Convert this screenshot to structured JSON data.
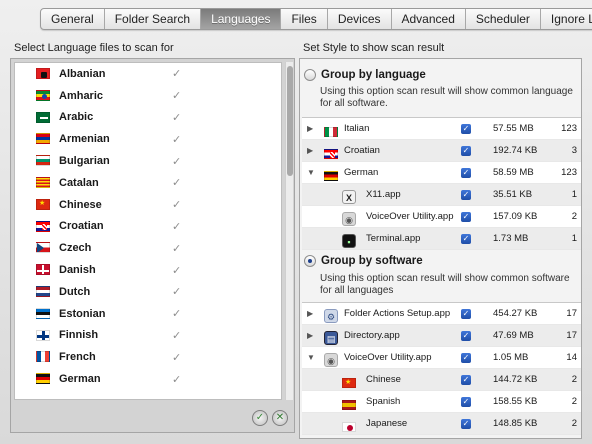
{
  "tabs": [
    {
      "label": "General",
      "active": false
    },
    {
      "label": "Folder Search",
      "active": false
    },
    {
      "label": "Languages",
      "active": true
    },
    {
      "label": "Files",
      "active": false
    },
    {
      "label": "Devices",
      "active": false
    },
    {
      "label": "Advanced",
      "active": false
    },
    {
      "label": "Scheduler",
      "active": false
    },
    {
      "label": "Ignore List",
      "active": false
    }
  ],
  "left_panel": {
    "title": "Select Language files to scan for",
    "languages": [
      {
        "name": "Albanian",
        "checked": true,
        "flag": "albania"
      },
      {
        "name": "Amharic",
        "checked": true,
        "flag": "ethiopia"
      },
      {
        "name": "Arabic",
        "checked": true,
        "flag": "saudi-arabia"
      },
      {
        "name": "Armenian",
        "checked": true,
        "flag": "armenia"
      },
      {
        "name": "Bulgarian",
        "checked": true,
        "flag": "bulgaria"
      },
      {
        "name": "Catalan",
        "checked": true,
        "flag": "catalonia"
      },
      {
        "name": "Chinese",
        "checked": true,
        "flag": "china"
      },
      {
        "name": "Croatian",
        "checked": true,
        "flag": "croatia"
      },
      {
        "name": "Czech",
        "checked": true,
        "flag": "czech-republic"
      },
      {
        "name": "Danish",
        "checked": true,
        "flag": "denmark"
      },
      {
        "name": "Dutch",
        "checked": true,
        "flag": "netherlands"
      },
      {
        "name": "Estonian",
        "checked": true,
        "flag": "estonia"
      },
      {
        "name": "Finnish",
        "checked": true,
        "flag": "finland"
      },
      {
        "name": "French",
        "checked": true,
        "flag": "france"
      },
      {
        "name": "German",
        "checked": true,
        "flag": "germany"
      }
    ],
    "check_glyph": "✓",
    "select_all_icon": "check-circle-icon",
    "deselect_all_icon": "cancel-circle-icon"
  },
  "right_panel": {
    "title": "Set Style to show scan result",
    "by_language": {
      "label": "Group by language",
      "selected": false,
      "description": "Using this option scan result will show common language for all software.",
      "rows": [
        {
          "name": "Italian",
          "size": "57.55 MB",
          "count": "123",
          "expanded": false,
          "flag": "italy"
        },
        {
          "name": "Croatian",
          "size": "192.74 KB",
          "count": "3",
          "expanded": false,
          "flag": "croatia"
        },
        {
          "name": "German",
          "size": "58.59 MB",
          "count": "123",
          "expanded": true,
          "flag": "germany"
        }
      ],
      "children": [
        {
          "name": "X11.app",
          "size": "35.51 KB",
          "count": "1",
          "icon": "x11-app-icon"
        },
        {
          "name": "VoiceOver Utility.app",
          "size": "157.09 KB",
          "count": "2",
          "icon": "voiceover-app-icon"
        },
        {
          "name": "Terminal.app",
          "size": "1.73 MB",
          "count": "1",
          "icon": "terminal-app-icon"
        }
      ]
    },
    "by_software": {
      "label": "Group by software",
      "selected": true,
      "description": "Using this option scan result will show common software for all languages",
      "rows": [
        {
          "name": "Folder Actions Setup.app",
          "size": "454.27 KB",
          "count": "17",
          "expanded": false,
          "icon": "folder-actions-app-icon"
        },
        {
          "name": "Directory.app",
          "size": "47.69 MB",
          "count": "17",
          "expanded": false,
          "icon": "directory-app-icon"
        },
        {
          "name": "VoiceOver Utility.app",
          "size": "1.05 MB",
          "count": "14",
          "expanded": true,
          "icon": "voiceover-app-icon"
        }
      ],
      "children": [
        {
          "name": "Chinese",
          "size": "144.72 KB",
          "count": "2",
          "flag": "china"
        },
        {
          "name": "Spanish",
          "size": "158.55 KB",
          "count": "2",
          "flag": "spain"
        },
        {
          "name": "Japanese",
          "size": "148.85 KB",
          "count": "2",
          "flag": "japan"
        }
      ]
    },
    "check_glyph": "✓",
    "collapsed_glyph": "▶",
    "expanded_glyph": "▼"
  }
}
